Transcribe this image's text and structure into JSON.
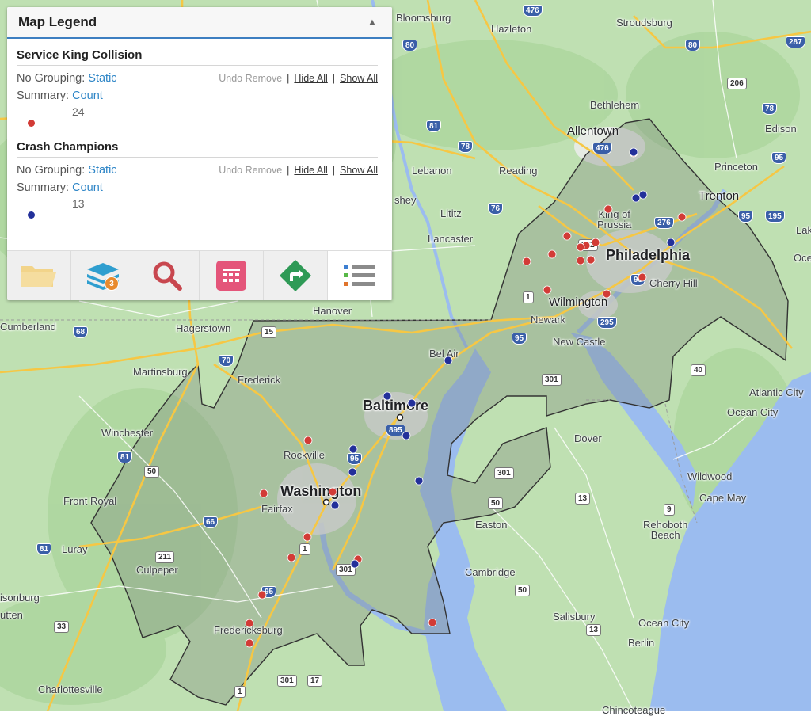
{
  "legend": {
    "title": "Map Legend",
    "layers": [
      {
        "name": "Service King Collision",
        "grouping_label": "No Grouping:",
        "grouping_value": "Static",
        "summary_label": "Summary:",
        "summary_value": "Count",
        "undo_remove": "Undo Remove",
        "separator": "|",
        "hide_all": "Hide All",
        "show_all": "Show All",
        "count": "24",
        "color": "#d23b36"
      },
      {
        "name": "Crash Champions",
        "grouping_label": "No Grouping:",
        "grouping_value": "Static",
        "summary_label": "Summary:",
        "summary_value": "Count",
        "undo_remove": "Undo Remove",
        "separator": "|",
        "hide_all": "Hide All",
        "show_all": "Show All",
        "count": "13",
        "color": "#23309a"
      }
    ],
    "layers_badge": "3"
  },
  "toolbar_icons": [
    "folder-icon",
    "layers-icon",
    "search-icon",
    "calendar-icon",
    "directions-icon",
    "legend-list-icon"
  ],
  "places": {
    "bloomsburg": "Bloomsburg",
    "hazleton": "Hazleton",
    "stroudsburg": "Stroudsburg",
    "bethlehem": "Bethlehem",
    "allentown": "Allentown",
    "edison": "Edison",
    "lebanon": "Lebanon",
    "reading": "Reading",
    "princeton": "Princeton",
    "trenton": "Trenton",
    "lititz": "Lititz",
    "king_of_prussia": "King of\nPrussia",
    "lancaster": "Lancaster",
    "philadelphia": "Philadelphia",
    "cherry_hill": "Cherry Hill",
    "wilmington": "Wilmington",
    "newark": "Newark",
    "new_castle": "New Castle",
    "cumberland": "Cumberland",
    "hagerstown": "Hagerstown",
    "hanover": "Hanover",
    "bel_air": "Bel Air",
    "martinsburg": "Martinsburg",
    "frederick": "Frederick",
    "baltimore": "Baltimore",
    "atlantic_city": "Atlantic City",
    "ocean_city_nj": "Ocean City",
    "winchester": "Winchester",
    "rockville": "Rockville",
    "dover": "Dover",
    "wildwood": "Wildwood",
    "cape_may": "Cape May",
    "front_royal": "Front Royal",
    "washington": "Washington",
    "fairfax": "Fairfax",
    "easton": "Easton",
    "rehoboth": "Rehoboth\nBeach",
    "luray": "Luray",
    "cambridge": "Cambridge",
    "culpeper": "Culpeper",
    "salisbury": "Salisbury",
    "ocean_city_md": "Ocean City",
    "berlin": "Berlin",
    "fredericksburg": "Fredericksburg",
    "charlottesville": "Charlottesville",
    "harrisonburg": "isonburg",
    "staunton": "utten",
    "shey": "shey",
    "lake": "Lak",
    "ocean_nj": "Oce",
    "chincoteague": "Chincoteague"
  },
  "shields": {
    "i476a": "476",
    "i80a": "80",
    "i287": "287",
    "i80b": "80",
    "i206": "206",
    "i81a": "81",
    "i78a": "78",
    "i78b": "78",
    "i476b": "476",
    "i95a": "95",
    "i76": "76",
    "i276": "276",
    "i195": "195",
    "i95b": "95",
    "i202": "202",
    "i95c": "95",
    "us1a": "1",
    "i295": "295",
    "i68": "68",
    "us15": "15",
    "i70": "70",
    "i95d": "95",
    "i301a": "301",
    "us40": "40",
    "i895": "895",
    "i81b": "81",
    "us50a": "50",
    "i95e": "95",
    "i301b": "301",
    "us50b": "50",
    "i66": "66",
    "us13": "13",
    "us9": "9",
    "i81c": "81",
    "us211": "211",
    "us1b": "1",
    "i301c": "301",
    "us50c": "50",
    "i95f": "95",
    "us13b": "13",
    "us33": "33",
    "us301d": "301",
    "us17": "17",
    "us1c": "1"
  },
  "markers": {
    "service_king": [
      [
        800,
        193
      ],
      [
        768,
        264
      ],
      [
        861,
        274
      ],
      [
        716,
        298
      ],
      [
        740,
        310
      ],
      [
        752,
        306
      ],
      [
        733,
        312
      ],
      [
        697,
        321
      ],
      [
        665,
        330
      ],
      [
        733,
        329
      ],
      [
        746,
        328
      ],
      [
        811,
        350
      ],
      [
        691,
        366
      ],
      [
        766,
        371
      ],
      [
        389,
        556
      ],
      [
        333,
        623
      ],
      [
        420,
        621
      ],
      [
        388,
        678
      ],
      [
        368,
        704
      ],
      [
        452,
        706
      ],
      [
        331,
        751
      ],
      [
        315,
        787
      ],
      [
        315,
        812
      ],
      [
        546,
        786
      ]
    ],
    "crash_champions": [
      [
        800,
        192
      ],
      [
        812,
        246
      ],
      [
        803,
        250
      ],
      [
        847,
        306
      ],
      [
        566,
        455
      ],
      [
        489,
        500
      ],
      [
        520,
        509
      ],
      [
        513,
        550
      ],
      [
        446,
        567
      ],
      [
        445,
        596
      ],
      [
        529,
        607
      ],
      [
        423,
        638
      ],
      [
        448,
        712
      ]
    ]
  }
}
